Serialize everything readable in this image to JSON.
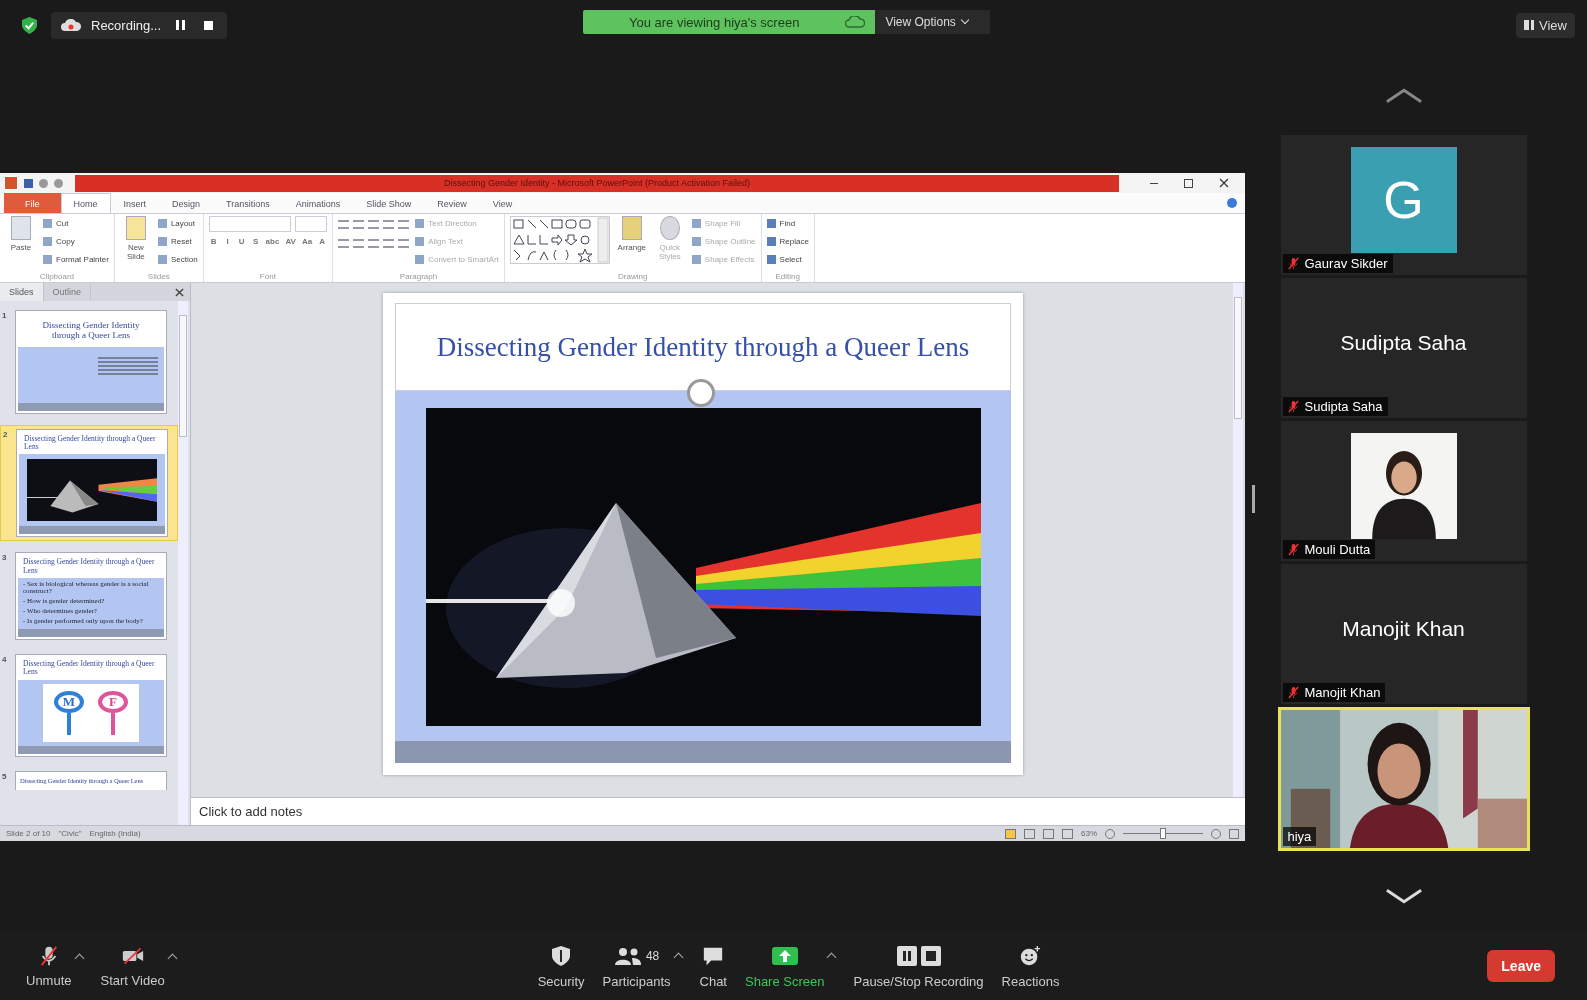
{
  "top_bar": {
    "recording": {
      "label": "Recording...",
      "paused": false
    },
    "banner": "You are viewing hiya's screen",
    "view_options": "View Options",
    "view_button": "View"
  },
  "powerpoint": {
    "title": "Dissecting Gender Identity  -  Microsoft PowerPoint (Product Activation Failed)",
    "tabs": [
      {
        "label": "File",
        "kind": "file",
        "selected": false
      },
      {
        "label": "Home",
        "kind": "tab",
        "selected": true
      },
      {
        "label": "Insert",
        "kind": "tab",
        "selected": false
      },
      {
        "label": "Design",
        "kind": "tab",
        "selected": false
      },
      {
        "label": "Transitions",
        "kind": "tab",
        "selected": false
      },
      {
        "label": "Animations",
        "kind": "tab",
        "selected": false
      },
      {
        "label": "Slide Show",
        "kind": "tab",
        "selected": false
      },
      {
        "label": "Review",
        "kind": "tab",
        "selected": false
      },
      {
        "label": "View",
        "kind": "tab",
        "selected": false
      }
    ],
    "groups": [
      {
        "name": "Clipboard",
        "kind": "clipboard",
        "big": "Paste",
        "items": [
          "Cut",
          "Copy",
          "Format Painter"
        ]
      },
      {
        "name": "Slides",
        "kind": "slides",
        "big": "New Slide",
        "items": [
          "Layout",
          "Reset",
          "Section"
        ]
      },
      {
        "name": "Font",
        "kind": "font",
        "items": [
          "B",
          "I",
          "U",
          "S",
          "abc",
          "AV",
          "Aa",
          "A"
        ]
      },
      {
        "name": "Paragraph",
        "kind": "paragraph",
        "items": [
          "Text Direction",
          "Align Text",
          "Convert to SmartArt"
        ]
      },
      {
        "name": "Drawing",
        "kind": "drawing",
        "big": "Arrange",
        "big2": "Quick Styles",
        "items": [
          "Shape Fill",
          "Shape Outline",
          "Shape Effects"
        ]
      },
      {
        "name": "Editing",
        "kind": "editing",
        "items": [
          "Find",
          "Replace",
          "Select"
        ]
      }
    ],
    "pane_tabs": [
      {
        "label": "Slides",
        "selected": true
      },
      {
        "label": "Outline",
        "selected": false
      }
    ],
    "thumbnails": [
      {
        "number": "1",
        "kind": "title",
        "selected": false,
        "title": "Dissecting Gender Identity through a Queer Lens"
      },
      {
        "number": "2",
        "kind": "picture",
        "selected": true,
        "title": "Dissecting Gender Identity through a Queer Lens"
      },
      {
        "number": "3",
        "kind": "bullets",
        "selected": false,
        "title": "Dissecting Gender Identity through a Queer Lens",
        "bullets": [
          "- Sex is biological whereas gender is a social construct?",
          "- How is gender determined?",
          "- Who determines gender?",
          "- Is gender performed only upon the body?"
        ]
      },
      {
        "number": "4",
        "kind": "symbols",
        "selected": false,
        "title": "Dissecting Gender Identity through a Queer Lens",
        "symbols": [
          "M",
          "F"
        ]
      },
      {
        "number": "5",
        "kind": "partial",
        "selected": false,
        "title": "Dissecting Gender Identity through a Queer Lens"
      }
    ],
    "slide": {
      "title": "Dissecting Gender Identity through a Queer Lens"
    },
    "notes_placeholder": "Click to add notes",
    "status": [
      "Slide 2 of 10",
      "\"Civic\"",
      "English (India)"
    ],
    "zoom": {
      "reading": "63%",
      "level": 0.5
    }
  },
  "participants": [
    {
      "name": "Gaurav Sikder",
      "kind": "initial",
      "initial": "G",
      "color": "#3a9fb0",
      "muted": true,
      "speaking": false
    },
    {
      "name": "Sudipta Saha",
      "display_name": "Sudipta Saha",
      "kind": "name",
      "muted": true,
      "speaking": false
    },
    {
      "name": "Mouli Dutta",
      "muted": true,
      "speaking": false
    },
    {
      "name": "Manojit Khan",
      "display_name": "Manojit Khan",
      "kind": "name",
      "muted": true,
      "speaking": false
    },
    {
      "name": "hiya",
      "kind": "video",
      "muted": false,
      "speaking": true
    }
  ],
  "toolbar": [
    {
      "label": "Unmute",
      "kind": "mic",
      "caret": true
    },
    {
      "label": "Start Video",
      "kind": "video",
      "caret": true
    },
    {
      "label": "Security",
      "kind": "security",
      "caret": false
    },
    {
      "label": "Participants",
      "kind": "participants",
      "count": "48",
      "caret": true
    },
    {
      "label": "Chat",
      "kind": "chat",
      "caret": false
    },
    {
      "label": "Share Screen",
      "kind": "share",
      "caret": true
    },
    {
      "label": "Pause/Stop Recording",
      "kind": "recording",
      "caret": false
    },
    {
      "label": "Reactions",
      "kind": "reactions",
      "caret": false
    }
  ],
  "leave": "Leave"
}
